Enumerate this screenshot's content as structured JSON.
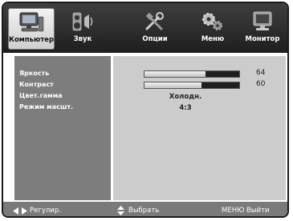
{
  "tabs": [
    {
      "label": "Компьютер",
      "icon": "computer-icon",
      "active": true
    },
    {
      "label": "Звук",
      "icon": "sound-icon",
      "active": false
    },
    {
      "label": "Опции",
      "icon": "tools-icon",
      "active": false
    },
    {
      "label": "Меню",
      "icon": "gears-icon",
      "active": false
    },
    {
      "label": "Монитор",
      "icon": "monitor-icon",
      "active": false
    }
  ],
  "settings": {
    "brightness": {
      "label": "Яркость",
      "value": "64",
      "level": 0.64
    },
    "contrast": {
      "label": "Контраст",
      "value": "60",
      "level": 0.6
    },
    "color_gamut": {
      "label": "Цвет.гамма",
      "value": "Холодн."
    },
    "scale_mode": {
      "label": "Режим масшт.",
      "value": "4:3"
    }
  },
  "hints": {
    "adjust": "Регулир.",
    "select": "Выбрать",
    "exit": "МЕНЮ Выйти"
  },
  "colors": {
    "tab_bar": "#2b2b2b",
    "left_panel": "#7d7d7d",
    "right_panel": "#cccccc",
    "hint_bar": "#7a7a7a"
  }
}
